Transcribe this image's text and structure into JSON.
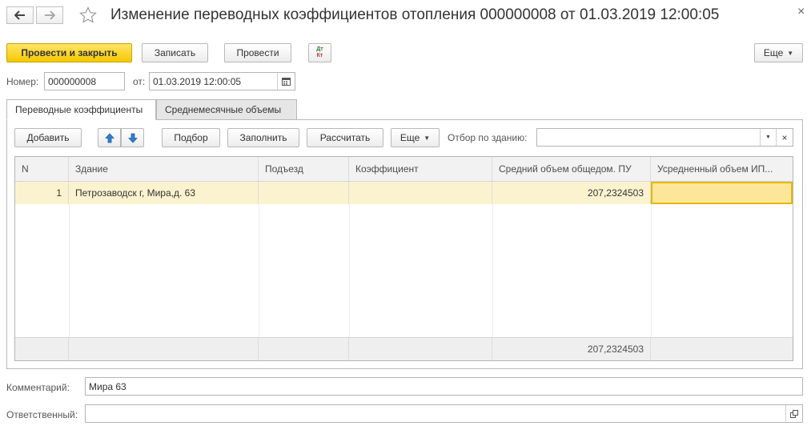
{
  "window": {
    "title": "Изменение переводных коэффициентов отопления 000000008 от 01.03.2019 12:00:05",
    "close_glyph": "×"
  },
  "toolbar": {
    "post_close": "Провести и закрыть",
    "save": "Записать",
    "post": "Провести",
    "dtkt_top": "Дт",
    "dtkt_bottom": "Кт",
    "more": "Еще"
  },
  "header": {
    "number_label": "Номер:",
    "number_value": "000000008",
    "date_label": "от:",
    "date_value": "01.03.2019 12:00:05"
  },
  "tabs": [
    {
      "label": "Переводные коэффициенты",
      "active": true
    },
    {
      "label": "Среднемесячные объемы",
      "active": false
    }
  ],
  "table_toolbar": {
    "add": "Добавить",
    "pick": "Подбор",
    "fill": "Заполнить",
    "calculate": "Рассчитать",
    "more": "Еще",
    "filter_label": "Отбор по зданию:",
    "filter_value": ""
  },
  "table": {
    "columns": [
      "N",
      "Здание",
      "Подъезд",
      "Коэффициент",
      "Средний объем общедом. ПУ",
      "Усредненный объем ИП..."
    ],
    "rows": [
      {
        "n": "1",
        "building": "Петрозаводск г, Мира,д. 63",
        "entrance": "",
        "coef": "",
        "avg_volume": "207,2324503",
        "avg_ip": ""
      }
    ],
    "footer_total": "207,2324503"
  },
  "form": {
    "comment_label": "Комментарий:",
    "comment_value": "Мира 63",
    "responsible_label": "Ответственный:",
    "responsible_value": ""
  },
  "colors": {
    "primary_button": "#f5c800",
    "selected_row": "#fbf3cf",
    "active_cell_border": "#e5b800",
    "arrow_blue": "#2f7fd1"
  }
}
